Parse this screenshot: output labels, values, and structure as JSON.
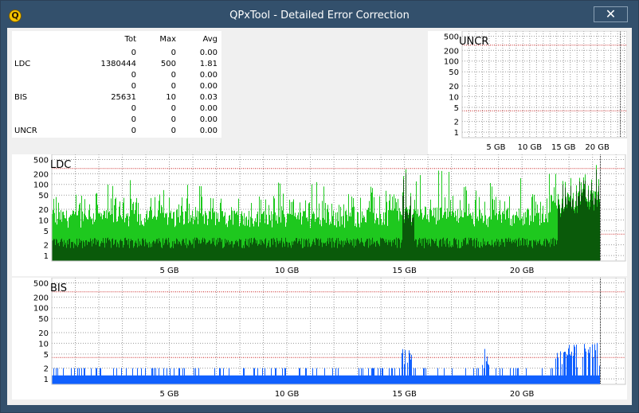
{
  "window": {
    "title": "QPxTool - Detailed Error Correction",
    "close_glyph": "✕",
    "icon_letter": "Q"
  },
  "stats": {
    "headers": {
      "tot": "Tot",
      "max": "Max",
      "avg": "Avg"
    },
    "rows": [
      {
        "label": "",
        "tot": "0",
        "max": "0",
        "avg": "0.00"
      },
      {
        "label": "LDC",
        "tot": "1380444",
        "max": "500",
        "avg": "1.81"
      },
      {
        "label": "",
        "tot": "0",
        "max": "0",
        "avg": "0.00"
      },
      {
        "label": "",
        "tot": "0",
        "max": "0",
        "avg": "0.00"
      },
      {
        "label": "BIS",
        "tot": "25631",
        "max": "10",
        "avg": "0.03"
      },
      {
        "label": "",
        "tot": "0",
        "max": "0",
        "avg": "0.00"
      },
      {
        "label": "",
        "tot": "0",
        "max": "0",
        "avg": "0.00"
      },
      {
        "label": "UNCR",
        "tot": "0",
        "max": "0",
        "avg": "0.00"
      }
    ]
  },
  "colors": {
    "ldc_light": "#1ec81e",
    "ldc_dark": "#0a5a0a",
    "bis": "#1060ff",
    "limit_line": "#c81e1e",
    "grid": "#9a9a9a",
    "frame": "#33506c",
    "background": "#f0f0f0"
  },
  "chart_data": [
    {
      "type": "bar",
      "title": "UNCR",
      "scale": "log",
      "yticks": [
        1,
        2,
        5,
        10,
        20,
        50,
        100,
        200,
        500
      ],
      "ytick_labels": [
        "1",
        "2",
        "5",
        "10",
        "20",
        "50",
        "100",
        "200",
        "500"
      ],
      "xticks": [
        5,
        10,
        15,
        20
      ],
      "xtick_labels": [
        "5 GB",
        "10 GB",
        "15 GB",
        "20 GB"
      ],
      "xlim": [
        0,
        24.4
      ],
      "ylim": [
        0.7,
        700
      ],
      "limit_lines": [
        280,
        4
      ],
      "disc_end_gb": 23.3,
      "values": []
    },
    {
      "type": "bar",
      "title": "LDC",
      "scale": "log",
      "yticks": [
        1,
        2,
        5,
        10,
        20,
        50,
        100,
        200,
        500
      ],
      "ytick_labels": [
        "1",
        "2",
        "5",
        "10",
        "20",
        "50",
        "100",
        "200",
        "500"
      ],
      "xticks": [
        5,
        10,
        15,
        20
      ],
      "xtick_labels": [
        "5 GB",
        "10 GB",
        "15 GB",
        "20 GB"
      ],
      "xlim": [
        0,
        24.4
      ],
      "ylim": [
        0.7,
        700
      ],
      "limit_lines": [
        280,
        4
      ],
      "disc_end_gb": 23.3,
      "profile": [
        {
          "x": 0.0,
          "baseline": 12,
          "peak": 40
        },
        {
          "x": 3.3,
          "baseline": 12,
          "peak": 150
        },
        {
          "x": 4.5,
          "baseline": 12,
          "peak": 110
        },
        {
          "x": 8.3,
          "baseline": 12,
          "peak": 120
        },
        {
          "x": 11.3,
          "baseline": 12,
          "peak": 120
        },
        {
          "x": 14.0,
          "baseline": 12,
          "peak": 90
        },
        {
          "x": 15.0,
          "baseline": 18,
          "peak": 300
        },
        {
          "x": 16.6,
          "baseline": 14,
          "peak": 300
        },
        {
          "x": 18.0,
          "baseline": 12,
          "peak": 90
        },
        {
          "x": 21.0,
          "baseline": 14,
          "peak": 200
        },
        {
          "x": 22.0,
          "baseline": 40,
          "peak": 330
        },
        {
          "x": 23.3,
          "baseline": 40,
          "peak": 450
        }
      ]
    },
    {
      "type": "bar",
      "title": "BIS",
      "scale": "log",
      "yticks": [
        1,
        2,
        5,
        10,
        20,
        50,
        100,
        200,
        500
      ],
      "ytick_labels": [
        "1",
        "2",
        "5",
        "10",
        "20",
        "50",
        "100",
        "200",
        "500"
      ],
      "xticks": [
        5,
        10,
        15,
        20
      ],
      "xtick_labels": [
        "5 GB",
        "10 GB",
        "15 GB",
        "20 GB"
      ],
      "xlim": [
        0,
        24.4
      ],
      "ylim": [
        0.7,
        700
      ],
      "limit_lines": [
        280,
        4
      ],
      "disc_end_gb": 23.3,
      "profile": [
        {
          "x": 0.0,
          "baseline": 1,
          "peak": 2
        },
        {
          "x": 3.4,
          "baseline": 1,
          "peak": 4
        },
        {
          "x": 15.0,
          "baseline": 1,
          "peak": 6
        },
        {
          "x": 18.3,
          "baseline": 1,
          "peak": 8
        },
        {
          "x": 21.2,
          "baseline": 1,
          "peak": 7
        },
        {
          "x": 23.2,
          "baseline": 1,
          "peak": 10
        }
      ]
    }
  ]
}
